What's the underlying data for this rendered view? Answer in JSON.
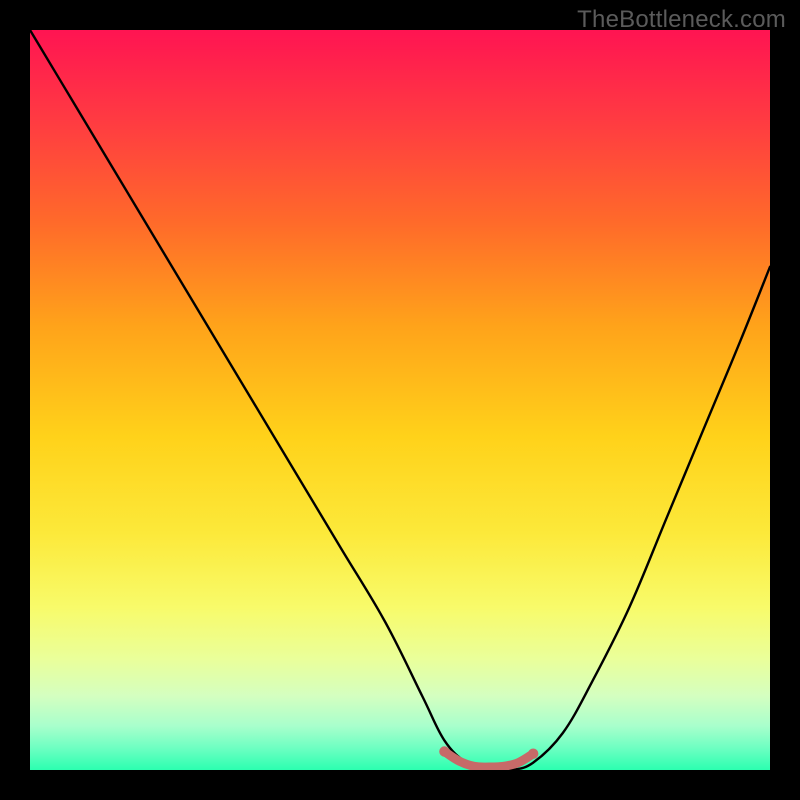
{
  "watermark": "TheBottleneck.com",
  "chart_data": {
    "type": "line",
    "title": "",
    "xlabel": "",
    "ylabel": "",
    "xlim": [
      0,
      100
    ],
    "ylim": [
      0,
      100
    ],
    "grid": false,
    "legend": false,
    "background_gradient": {
      "top_color": "#ff1452",
      "bottom_color": "#2bffb0",
      "description": "vertical rainbow gradient from red (top) through orange and yellow to green (bottom)"
    },
    "series": [
      {
        "name": "bottleneck-curve",
        "color": "#000000",
        "x": [
          0,
          6,
          12,
          18,
          24,
          30,
          36,
          42,
          48,
          53,
          56,
          59,
          62,
          65,
          68,
          72,
          76,
          81,
          86,
          91,
          96,
          100
        ],
        "values": [
          100,
          90,
          80,
          70,
          60,
          50,
          40,
          30,
          20,
          10,
          4,
          1,
          0,
          0,
          1,
          5,
          12,
          22,
          34,
          46,
          58,
          68
        ]
      },
      {
        "name": "bottom-highlight",
        "color": "#c76a68",
        "x": [
          56,
          58,
          60,
          62,
          64,
          66,
          68
        ],
        "values": [
          2.5,
          1.2,
          0.5,
          0.4,
          0.5,
          1.0,
          2.2
        ]
      }
    ],
    "annotations": []
  }
}
